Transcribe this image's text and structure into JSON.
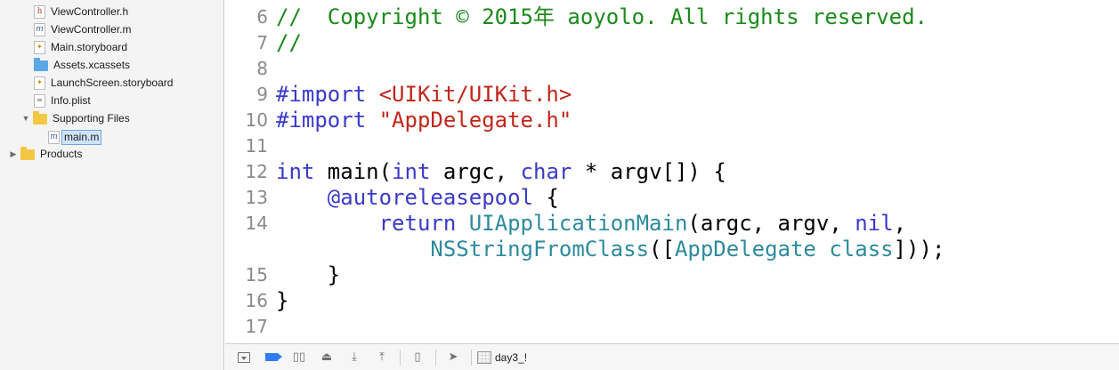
{
  "sidebar": {
    "items": [
      {
        "label": "ViewController.h",
        "icon": "h"
      },
      {
        "label": "ViewController.m",
        "icon": "m"
      },
      {
        "label": "Main.storyboard",
        "icon": "storyboard"
      },
      {
        "label": "Assets.xcassets",
        "icon": "assets-folder"
      },
      {
        "label": "LaunchScreen.storyboard",
        "icon": "storyboard"
      },
      {
        "label": "Info.plist",
        "icon": "plist"
      },
      {
        "label": "Supporting Files",
        "icon": "folder",
        "expanded": true
      },
      {
        "label": "main.m",
        "icon": "m",
        "selected": true
      },
      {
        "label": "Products",
        "icon": "folder",
        "expanded": false
      }
    ],
    "icon_glyphs": {
      "h": "h",
      "m": "m",
      "sb": "✦",
      "plist": "≡"
    }
  },
  "editor": {
    "lines": [
      {
        "num": "6",
        "segments": [
          {
            "text": "//  Copyright © 2015年 aoyolo. All rights reserved.",
            "style": "comment"
          }
        ]
      },
      {
        "num": "7",
        "segments": [
          {
            "text": "//",
            "style": "comment"
          }
        ]
      },
      {
        "num": "8",
        "segments": []
      },
      {
        "num": "9",
        "segments": [
          {
            "text": "#import ",
            "style": "pre"
          },
          {
            "text": "<UIKit/UIKit.h>",
            "style": "str"
          }
        ]
      },
      {
        "num": "10",
        "segments": [
          {
            "text": "#import ",
            "style": "pre"
          },
          {
            "text": "\"AppDelegate.h\"",
            "style": "str"
          }
        ]
      },
      {
        "num": "11",
        "segments": []
      },
      {
        "num": "12",
        "segments": [
          {
            "text": "int",
            "style": "kw"
          },
          {
            "text": " main(",
            "style": "plain"
          },
          {
            "text": "int",
            "style": "kw"
          },
          {
            "text": " argc, ",
            "style": "plain"
          },
          {
            "text": "char",
            "style": "kw"
          },
          {
            "text": " * argv[]) {",
            "style": "plain"
          }
        ]
      },
      {
        "num": "13",
        "segments": [
          {
            "text": "    ",
            "style": "plain"
          },
          {
            "text": "@autoreleasepool",
            "style": "kw"
          },
          {
            "text": " {",
            "style": "plain"
          }
        ]
      },
      {
        "num": "14",
        "segments": [
          {
            "text": "        ",
            "style": "plain"
          },
          {
            "text": "return",
            "style": "kw"
          },
          {
            "text": " ",
            "style": "plain"
          },
          {
            "text": "UIApplicationMain",
            "style": "type"
          },
          {
            "text": "(argc, argv, ",
            "style": "plain"
          },
          {
            "text": "nil",
            "style": "kw"
          },
          {
            "text": ",",
            "style": "plain"
          }
        ]
      },
      {
        "num": "",
        "segments": [
          {
            "text": "            ",
            "style": "plain"
          },
          {
            "text": "NSStringFromClass",
            "style": "type"
          },
          {
            "text": "([",
            "style": "plain"
          },
          {
            "text": "AppDelegate",
            "style": "type"
          },
          {
            "text": " ",
            "style": "plain"
          },
          {
            "text": "class",
            "style": "type"
          },
          {
            "text": "]));",
            "style": "plain"
          }
        ]
      },
      {
        "num": "15",
        "segments": [
          {
            "text": "    }",
            "style": "plain"
          }
        ]
      },
      {
        "num": "16",
        "segments": [
          {
            "text": "}",
            "style": "plain"
          }
        ]
      },
      {
        "num": "17",
        "segments": []
      }
    ]
  },
  "debugbar": {
    "scheme_label": "day3_!",
    "buttons": [
      {
        "name": "hide-debug-area",
        "glyph": "box"
      },
      {
        "name": "breakpoints-toggle",
        "glyph": "bp",
        "active": true
      },
      {
        "name": "pause-continue",
        "glyph": "▯▯"
      },
      {
        "name": "step-over",
        "glyph": "⏏"
      },
      {
        "name": "step-into",
        "glyph": "⤓"
      },
      {
        "name": "step-out",
        "glyph": "⤒"
      },
      {
        "name": "view-hierarchy",
        "glyph": "▯"
      },
      {
        "name": "simulate-location",
        "glyph": "➤"
      }
    ]
  },
  "colors": {
    "comment": "#1b8a1b",
    "keyword": "#3a3ac9",
    "string": "#c1261a",
    "type": "#2e8a9c",
    "accent": "#2f7cf6"
  }
}
